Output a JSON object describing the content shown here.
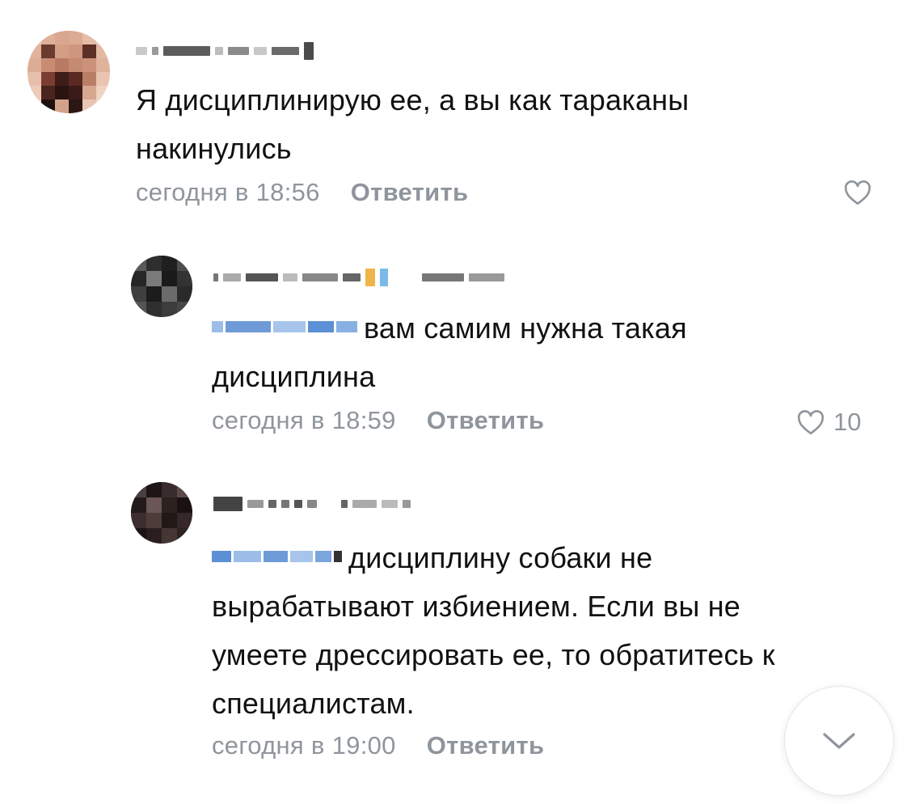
{
  "comments": [
    {
      "text": "Я дисциплинирую ее, а вы как тараканы накинулись",
      "time": "сегодня в 18:56",
      "reply_label": "Ответить",
      "likes": ""
    },
    {
      "text": "вам самим нужна такая дисциплина",
      "time": "сегодня в 18:59",
      "reply_label": "Ответить",
      "likes": "10"
    },
    {
      "text": "дисциплину собаки не вырабатывают избиением. Если вы не умеете дрессировать ее, то обратитесь к специалистам.",
      "time": "сегодня в 19:00",
      "reply_label": "Ответить",
      "likes": ""
    }
  ],
  "icons": {
    "like": "heart-icon",
    "scroll": "chevron-down-icon"
  },
  "colors": {
    "meta": "#8f959c",
    "mention": "#5b8fd6",
    "text": "#111111"
  }
}
